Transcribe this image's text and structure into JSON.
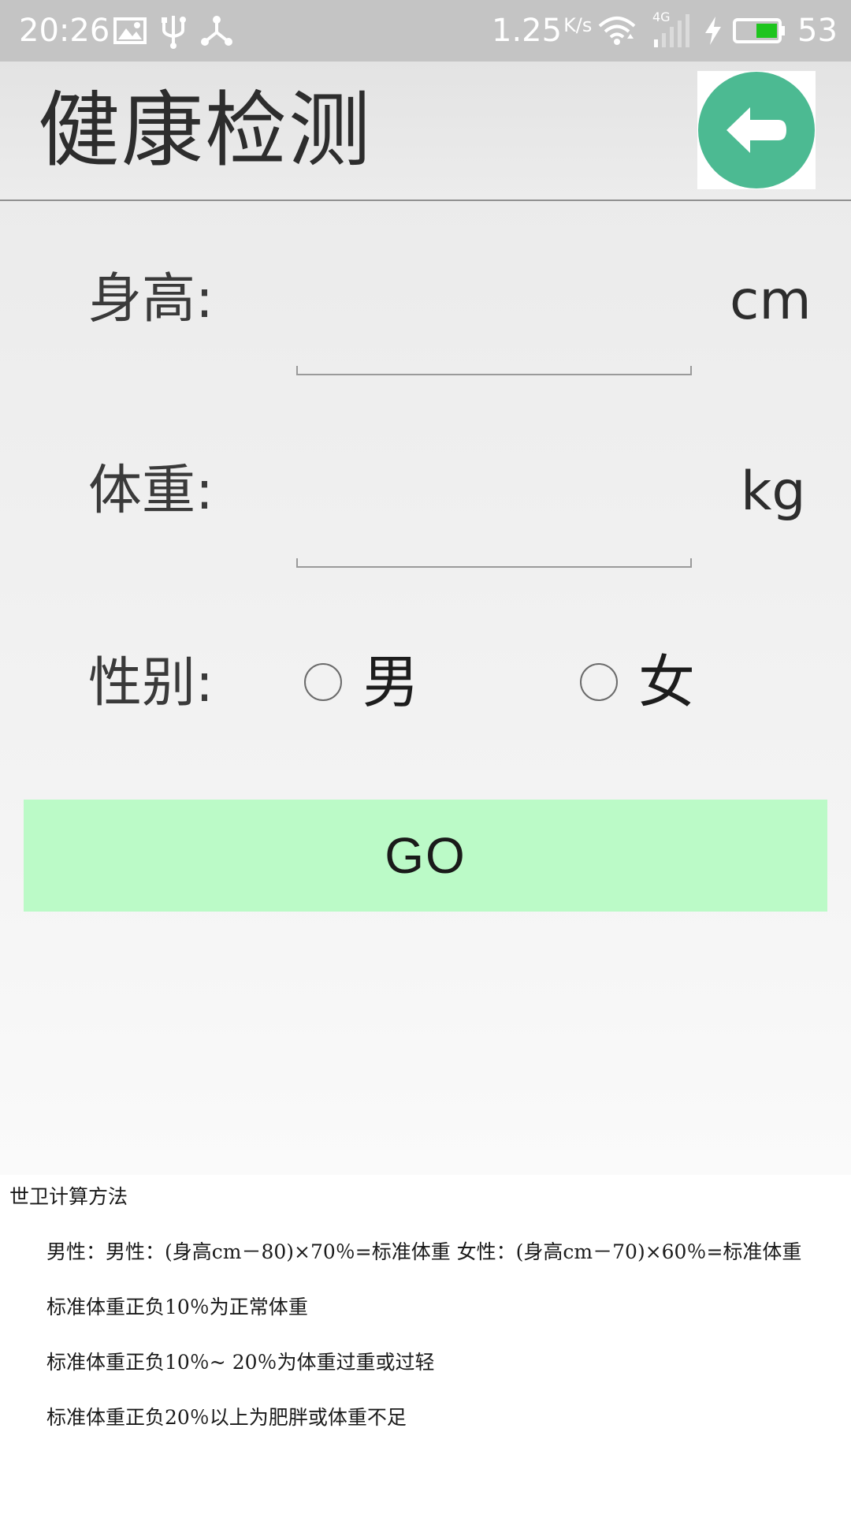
{
  "status_bar": {
    "time": "20:26",
    "network_speed": "1.25",
    "speed_unit": "K/s",
    "network_type": "4G",
    "battery_percent": "53",
    "battery_color": "#1ec51e",
    "icons": [
      "image-icon",
      "usb-icon",
      "share-hub-icon",
      "wifi-icon",
      "signal-icon",
      "charging-icon",
      "battery-icon"
    ]
  },
  "toolbar": {
    "title": "健康检测",
    "back_icon": "arrow-left-icon",
    "back_color": "#4cba92"
  },
  "form": {
    "height_label": "身高:",
    "height_value": "",
    "height_unit": "cm",
    "weight_label": "体重:",
    "weight_value": "",
    "weight_unit": "kg",
    "gender_label": "性别:",
    "gender_options": [
      {
        "label": "男",
        "selected": false
      },
      {
        "label": "女",
        "selected": false
      }
    ]
  },
  "go_button": {
    "label": "GO",
    "color": "#bbfac7"
  },
  "info": {
    "title": "世卫计算方法",
    "lines": [
      "男性：男性：(身高cm－80)×70％=标准体重 女性：(身高cm－70)×60％=标准体重",
      "标准体重正负10％为正常体重",
      "标准体重正负10％~ 20％为体重过重或过轻",
      "标准体重正负20％以上为肥胖或体重不足"
    ]
  }
}
